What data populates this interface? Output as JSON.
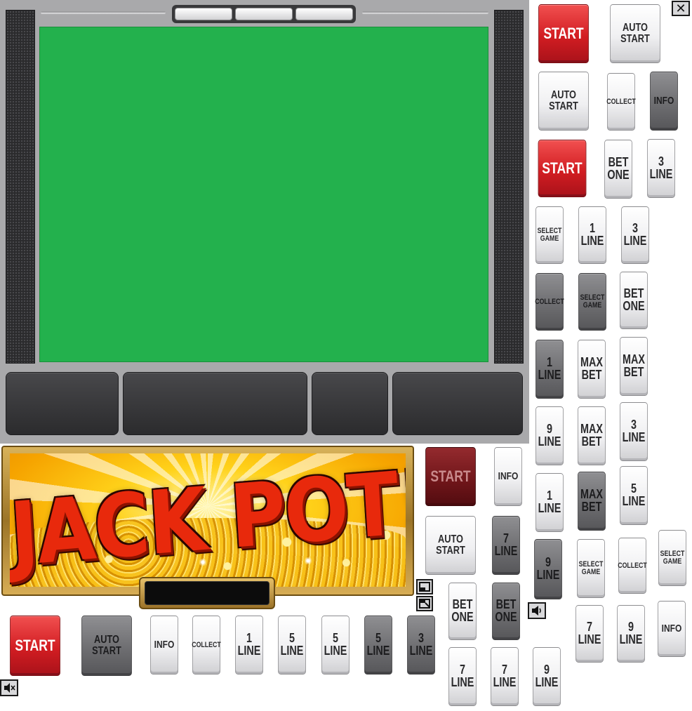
{
  "close_button": {
    "glyph": "✕"
  },
  "banner": {
    "title": "JACK POT!"
  },
  "buttons": [
    {
      "id": "r1-start",
      "label": "START",
      "style": "red",
      "size": "big"
    },
    {
      "id": "r1-auto-start",
      "label": "AUTO\nSTART",
      "style": "white",
      "size": "two"
    },
    {
      "id": "r2-auto-start",
      "label": "AUTO\nSTART",
      "style": "white",
      "size": "two"
    },
    {
      "id": "r2-collect",
      "label": "COLLECT",
      "style": "white",
      "size": "small"
    },
    {
      "id": "r2-info",
      "label": "INFO",
      "style": "dark",
      "size": "info"
    },
    {
      "id": "r3-start",
      "label": "START",
      "style": "red",
      "size": "big"
    },
    {
      "id": "r3-bet-one",
      "label": "BET\nONE",
      "style": "white",
      "size": "line"
    },
    {
      "id": "r3-3-line",
      "label": "3\nLINE",
      "style": "white",
      "size": "line"
    },
    {
      "id": "r4-select-game",
      "label": "SELECT\nGAME",
      "style": "white",
      "size": "small"
    },
    {
      "id": "r4-1-line",
      "label": "1\nLINE",
      "style": "white",
      "size": "line"
    },
    {
      "id": "r4-3-line",
      "label": "3\nLINE",
      "style": "white",
      "size": "line"
    },
    {
      "id": "r5-collect",
      "label": "COLLECT",
      "style": "dark",
      "size": "small"
    },
    {
      "id": "r5-select-game",
      "label": "SELECT\nGAME",
      "style": "dark",
      "size": "small"
    },
    {
      "id": "r5-bet-one",
      "label": "BET\nONE",
      "style": "white",
      "size": "line"
    },
    {
      "id": "r6-1-line",
      "label": "1\nLINE",
      "style": "dark",
      "size": "line"
    },
    {
      "id": "r6-max-bet",
      "label": "MAX\nBET",
      "style": "white",
      "size": "line"
    },
    {
      "id": "r6-max-bet-b",
      "label": "MAX\nBET",
      "style": "white",
      "size": "line"
    },
    {
      "id": "r7-9-line",
      "label": "9\nLINE",
      "style": "white",
      "size": "line"
    },
    {
      "id": "r7-max-bet",
      "label": "MAX\nBET",
      "style": "white",
      "size": "line"
    },
    {
      "id": "r7-3-line",
      "label": "3\nLINE",
      "style": "white",
      "size": "line"
    },
    {
      "id": "m-start-disabled",
      "label": "START",
      "style": "maroon",
      "size": "big"
    },
    {
      "id": "m-info",
      "label": "INFO",
      "style": "white",
      "size": "info"
    },
    {
      "id": "m-1-line",
      "label": "1\nLINE",
      "style": "white",
      "size": "line"
    },
    {
      "id": "m-max-bet-dark",
      "label": "MAX\nBET",
      "style": "dark",
      "size": "line"
    },
    {
      "id": "m-5-line",
      "label": "5\nLINE",
      "style": "white",
      "size": "line"
    },
    {
      "id": "m-auto-start",
      "label": "AUTO\nSTART",
      "style": "white",
      "size": "two"
    },
    {
      "id": "m-7-line-dark",
      "label": "7\nLINE",
      "style": "dark",
      "size": "line"
    },
    {
      "id": "m-9-line-dark",
      "label": "9\nLINE",
      "style": "dark",
      "size": "line"
    },
    {
      "id": "m-select-game",
      "label": "SELECT\nGAME",
      "style": "white",
      "size": "small"
    },
    {
      "id": "m-collect",
      "label": "COLLECT",
      "style": "white",
      "size": "small"
    },
    {
      "id": "m-select-game-b",
      "label": "SELECT\nGAME",
      "style": "white",
      "size": "small"
    },
    {
      "id": "m-bet-one",
      "label": "BET\nONE",
      "style": "white",
      "size": "line"
    },
    {
      "id": "m-bet-one-dark",
      "label": "BET\nONE",
      "style": "dark",
      "size": "line"
    },
    {
      "id": "m-7-line",
      "label": "7\nLINE",
      "style": "white",
      "size": "line"
    },
    {
      "id": "m-9-line",
      "label": "9\nLINE",
      "style": "white",
      "size": "line"
    },
    {
      "id": "m-info-b",
      "label": "INFO",
      "style": "white",
      "size": "info"
    },
    {
      "id": "b-start",
      "label": "START",
      "style": "red",
      "size": "big"
    },
    {
      "id": "b-auto-start",
      "label": "AUTO\nSTART",
      "style": "dark",
      "size": "two"
    },
    {
      "id": "b-info",
      "label": "INFO",
      "style": "white",
      "size": "info"
    },
    {
      "id": "b-collect",
      "label": "COLLECT",
      "style": "white",
      "size": "small"
    },
    {
      "id": "b-1-line",
      "label": "1\nLINE",
      "style": "white",
      "size": "line"
    },
    {
      "id": "b-5-line",
      "label": "5\nLINE",
      "style": "white",
      "size": "line"
    },
    {
      "id": "b-5-line-b",
      "label": "5\nLINE",
      "style": "white",
      "size": "line"
    },
    {
      "id": "b-5-line-dark",
      "label": "5\nLINE",
      "style": "dark",
      "size": "line"
    },
    {
      "id": "b-3-line-dark",
      "label": "3\nLINE",
      "style": "dark",
      "size": "line"
    },
    {
      "id": "b-7-line",
      "label": "7\nLINE",
      "style": "white",
      "size": "line"
    },
    {
      "id": "b-7-line-b",
      "label": "7\nLINE",
      "style": "white",
      "size": "line"
    },
    {
      "id": "b-9-line",
      "label": "9\nLINE",
      "style": "white",
      "size": "line"
    }
  ]
}
